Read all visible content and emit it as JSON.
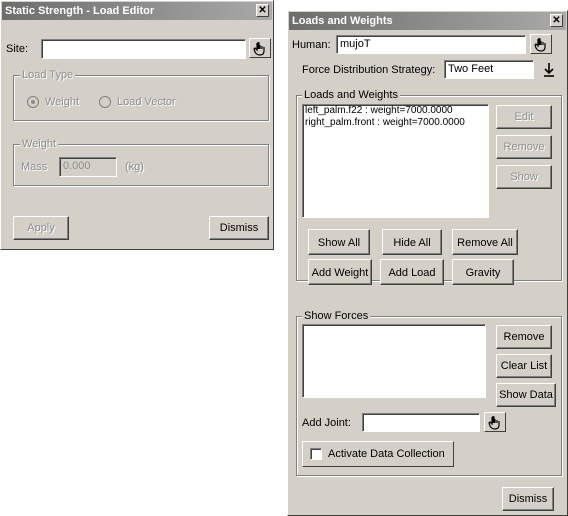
{
  "left_window": {
    "title": "Static Strength - Load Editor",
    "site_label": "Site:",
    "site_value": "",
    "load_type_legend": "Load Type",
    "radio_weight": "Weight",
    "radio_load_vector": "Load Vector",
    "weight_legend": "Weight",
    "mass_label": "Mass",
    "mass_value": "0.000",
    "mass_unit": "(kg)",
    "apply_button": "Apply",
    "dismiss_button": "Dismiss"
  },
  "right_window": {
    "title": "Loads and Weights",
    "human_label": "Human:",
    "human_value": "mujoT",
    "strategy_label": "Force Distribution Strategy:",
    "strategy_value": "Two Feet",
    "loads_legend": "Loads and Weights",
    "loads_items": [
      "left_palm.f22 : weight=7000.0000",
      "right_palm.front : weight=7000.0000"
    ],
    "edit_button": "Edit",
    "remove_button": "Remove",
    "show_button": "Show",
    "show_all_button": "Show All",
    "hide_all_button": "Hide All",
    "remove_all_button": "Remove All",
    "add_weight_button": "Add Weight",
    "add_load_button": "Add Load",
    "gravity_button": "Gravity",
    "show_forces_legend": "Show Forces",
    "forces_remove_button": "Remove",
    "clear_list_button": "Clear List",
    "show_data_button": "Show Data",
    "add_joint_label": "Add Joint:",
    "add_joint_value": "",
    "activate_label": "Activate Data Collection",
    "dismiss_button": "Dismiss"
  },
  "icons": {
    "close": "close-icon",
    "pick_hand": "hand-pointer-icon",
    "dropdown": "dropdown-arrow-icon"
  }
}
